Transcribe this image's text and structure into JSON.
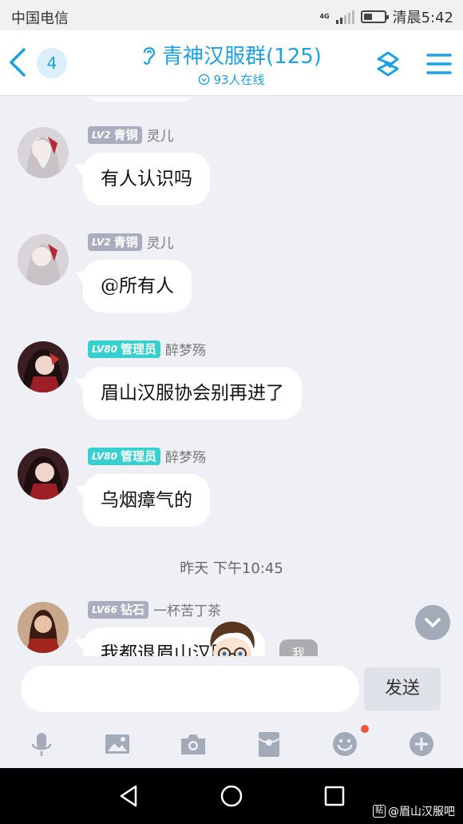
{
  "status_bar": {
    "carrier": "中国电信",
    "network": "4G",
    "time": "清晨5:42",
    "battery_level": 0.45
  },
  "header": {
    "unread_count": "4",
    "title": "青神汉服群(125)",
    "online": "93人在线",
    "accent_color": "#1ba2e6"
  },
  "messages": [
    {
      "level": "LV2",
      "rank": "青铜",
      "name": "灵儿",
      "text": "有人认识吗",
      "badge_color": "#a9adbd"
    },
    {
      "level": "LV2",
      "rank": "青铜",
      "name": "灵儿",
      "text": "@所有人",
      "badge_color": "#a9adbd"
    },
    {
      "level": "LV80",
      "rank": "管理员",
      "name": "醉梦殇",
      "text": "眉山汉服协会别再进了",
      "badge_color": "#36d1cf"
    },
    {
      "level": "LV80",
      "rank": "管理员",
      "name": "醉梦殇",
      "text": "乌烟瘴气的",
      "badge_color": "#36d1cf"
    },
    {
      "level": "LV66",
      "rank": "钻石",
      "name": "一杯苦丁茶",
      "text": "我都退眉山汉服群",
      "badge_color": "#a9adbd"
    }
  ],
  "timestamp": "昨天 下午10:45",
  "me_tag": "我",
  "input": {
    "placeholder": "",
    "send_label": "发送"
  },
  "toolbar_icons": [
    "microphone-icon",
    "image-icon",
    "camera-icon",
    "red-packet-icon",
    "emoji-icon",
    "plus-icon"
  ],
  "nav_icons": [
    "back-triangle-icon",
    "home-circle-icon",
    "recent-square-icon"
  ],
  "watermark": {
    "icon": "贴",
    "text": "@眉山汉服吧"
  }
}
